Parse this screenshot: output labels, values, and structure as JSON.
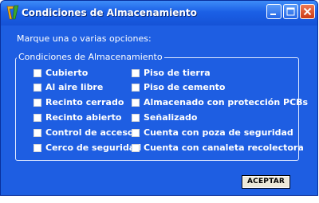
{
  "window": {
    "title": "Condiciones de Almacenamiento",
    "app_icon": "app-logo-icon",
    "controls": [
      "minimize-icon",
      "maximize-icon",
      "close-icon"
    ]
  },
  "prompt": "Marque una o varias opciones:",
  "group": {
    "legend": "Condiciones de Almacenamiento",
    "options": [
      {
        "label": "Cubierto",
        "checked": false
      },
      {
        "label": "Al aire libre",
        "checked": false
      },
      {
        "label": "Recinto cerrado",
        "checked": false
      },
      {
        "label": "Recinto abierto",
        "checked": false
      },
      {
        "label": "Control de acceso",
        "checked": false
      },
      {
        "label": "Cerco de seguridad",
        "checked": false
      },
      {
        "label": "Piso de tierra",
        "checked": false
      },
      {
        "label": "Piso de cemento",
        "checked": false
      },
      {
        "label": "Almacenado con protección PCBs",
        "checked": false
      },
      {
        "label": "Señalizado",
        "checked": false
      },
      {
        "label": "Cuenta con poza de seguridad",
        "checked": false
      },
      {
        "label": "Cuenta con canaleta recolectora",
        "checked": false
      }
    ]
  },
  "buttons": {
    "accept_label": "ACEPTAR"
  },
  "colors": {
    "titlebar": "#1b60e6",
    "client_background": "#1e5ee2",
    "close_button": "#cc3a14",
    "button_face": "#ece9d8"
  }
}
